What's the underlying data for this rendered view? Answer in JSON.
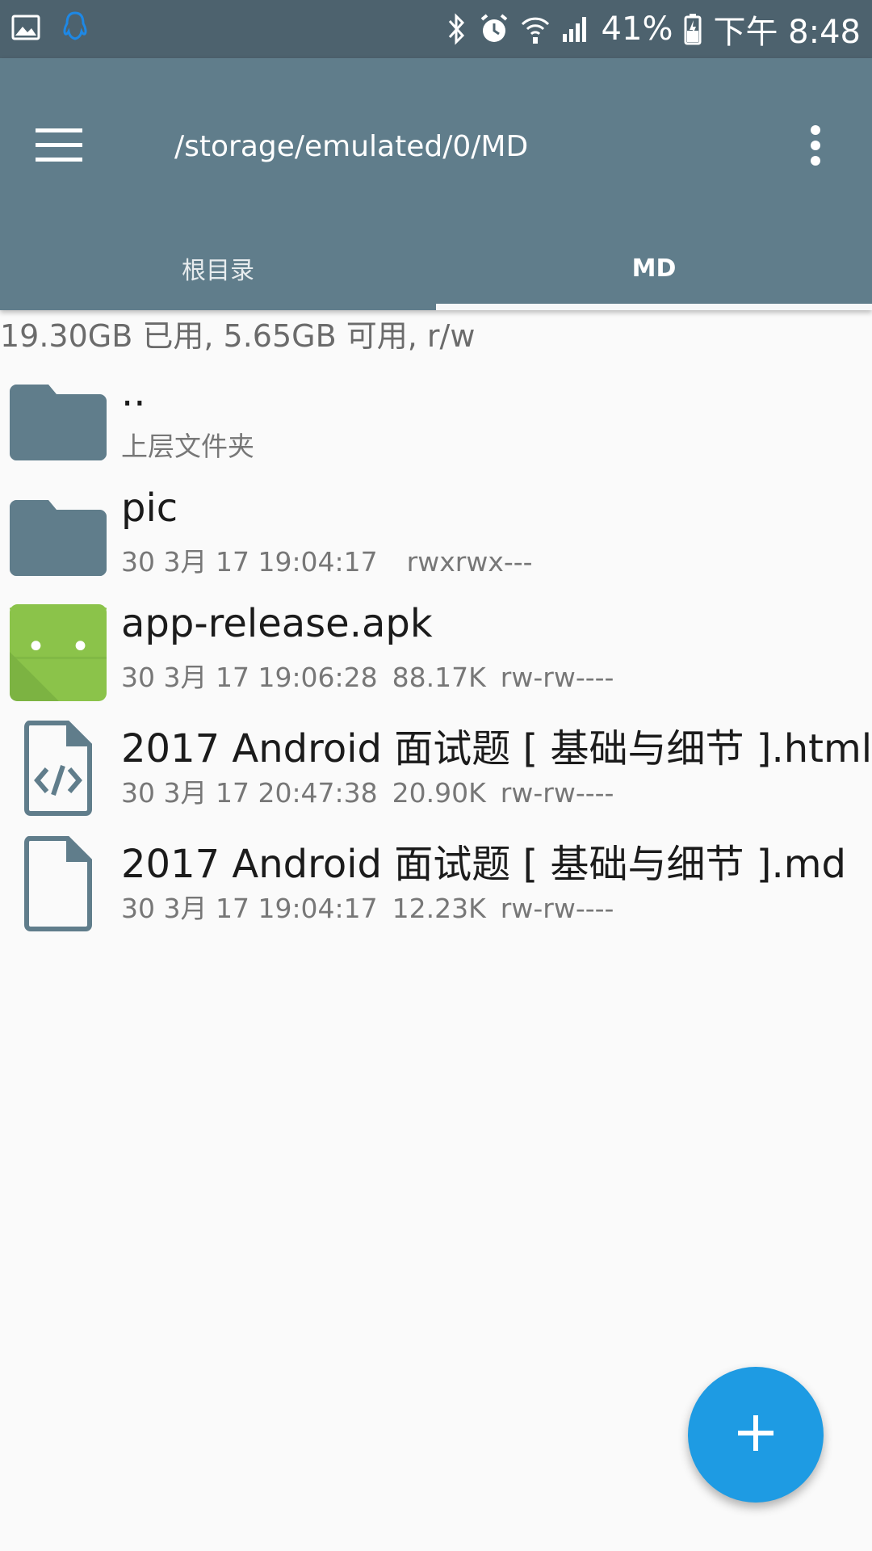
{
  "status_bar": {
    "battery_percent": "41%",
    "time": "下午 8:48",
    "icons": [
      "gallery-icon",
      "qq-icon",
      "bluetooth-icon",
      "alarm-icon",
      "wifi-icon",
      "signal-icon",
      "battery-icon"
    ]
  },
  "app_bar": {
    "path": "/storage/emulated/0/MD",
    "tabs": [
      {
        "label": "根目录",
        "active": false
      },
      {
        "label": "MD",
        "active": true
      }
    ],
    "color": "#607d8b"
  },
  "storage": {
    "info": "19.30GB 已用, 5.65GB 可用, r/w"
  },
  "files": [
    {
      "name": "..",
      "date": "",
      "size": "",
      "perm": "",
      "subtitle": "上层文件夹",
      "icon": "folder-icon"
    },
    {
      "name": "pic",
      "date": "30 3月 17 19:04:17",
      "size": "",
      "perm": "rwxrwx---",
      "icon": "folder-icon"
    },
    {
      "name": "app-release.apk",
      "date": "30 3月 17 19:06:28",
      "size": "88.17K",
      "perm": "rw-rw----",
      "icon": "android-icon"
    },
    {
      "name": "2017 Android 面试题 [ 基础与细节 ].html",
      "date": "30 3月 17 20:47:38",
      "size": "20.90K",
      "perm": "rw-rw----",
      "icon": "html-file-icon"
    },
    {
      "name": "2017 Android 面试题 [ 基础与细节 ].md",
      "date": "30 3月 17 19:04:17",
      "size": "12.23K",
      "perm": "rw-rw----",
      "icon": "file-icon"
    }
  ],
  "fab": {
    "icon": "plus-icon",
    "color": "#1e9be3"
  }
}
